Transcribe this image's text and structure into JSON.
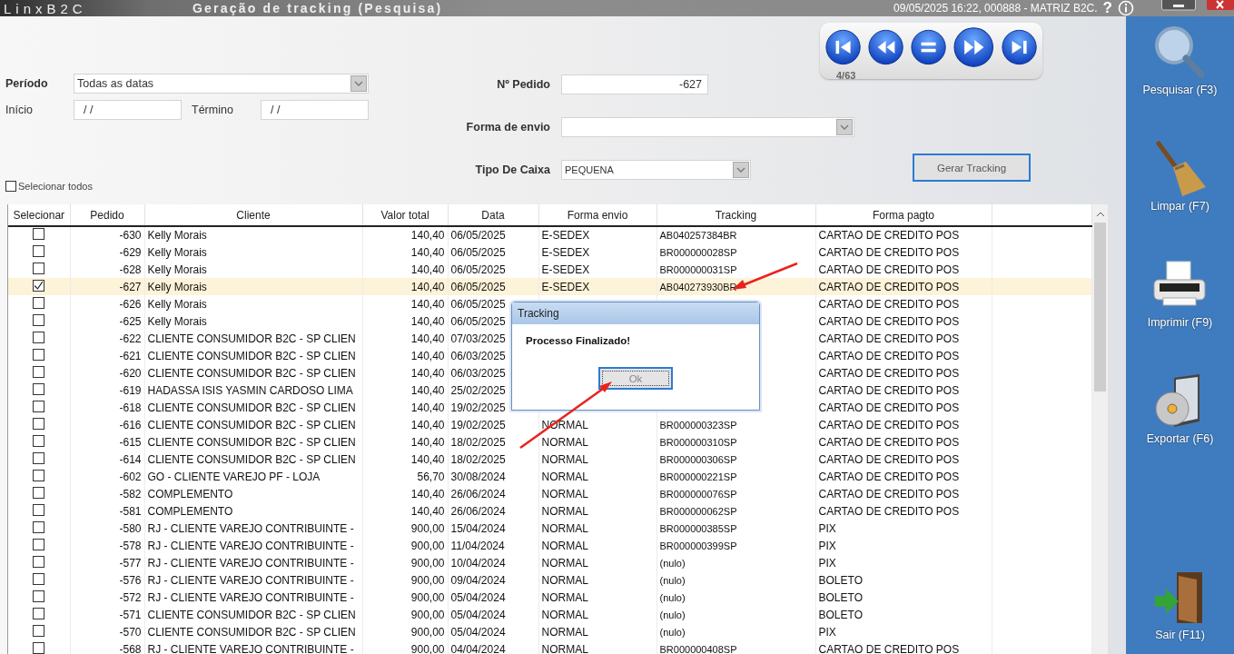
{
  "title_bar": {
    "app_name": "LinxB2C",
    "title": "Geração de tracking (Pesquisa)",
    "session": "09/05/2025 16:22, 000888 - MATRIZ B2C.",
    "help": "?"
  },
  "filters": {
    "periodo": {
      "label": "Período",
      "value": "Todas as datas"
    },
    "inicio": {
      "label": "Início",
      "value": "/ /"
    },
    "termino": {
      "label": "Término",
      "value": "/ /"
    },
    "pedido": {
      "label": "Nº Pedido",
      "value": "-627"
    },
    "forma_envio": {
      "label": "Forma de envio"
    },
    "tipo_caixa": {
      "label": "Tipo De Caixa",
      "value": "PEQUENA"
    },
    "select_all": {
      "label": "Selecionar todos",
      "checked": false
    },
    "generate_button": "Gerar Tracking"
  },
  "navigator": {
    "counter": "4/63"
  },
  "table": {
    "columns": [
      "Selecionar",
      "Pedido",
      "Cliente",
      "Valor total",
      "Data",
      "Forma envio",
      "Tracking",
      "Forma pagto"
    ],
    "rows": [
      {
        "checked": false,
        "selected": false,
        "pedido": "-630",
        "cliente": "Kelly Morais",
        "valor": "140,40",
        "data": "06/05/2025",
        "envio": "E-SEDEX",
        "tracking": "AB040257384BR",
        "pagto": "CARTAO DE CREDITO POS"
      },
      {
        "checked": false,
        "selected": false,
        "pedido": "-629",
        "cliente": "Kelly Morais",
        "valor": "140,40",
        "data": "06/05/2025",
        "envio": "E-SEDEX",
        "tracking": "BR000000028SP",
        "pagto": "CARTAO DE CREDITO POS"
      },
      {
        "checked": false,
        "selected": false,
        "pedido": "-628",
        "cliente": "Kelly Morais",
        "valor": "140,40",
        "data": "06/05/2025",
        "envio": "E-SEDEX",
        "tracking": "BR000000031SP",
        "pagto": "CARTAO DE CREDITO POS"
      },
      {
        "checked": true,
        "selected": true,
        "pedido": "-627",
        "cliente": "Kelly Morais",
        "valor": "140,40",
        "data": "06/05/2025",
        "envio": "E-SEDEX",
        "tracking": "AB040273930BR",
        "pagto": "CARTAO DE CREDITO POS"
      },
      {
        "checked": false,
        "selected": false,
        "pedido": "-626",
        "cliente": "Kelly Morais",
        "valor": "140,40",
        "data": "06/05/2025",
        "pagto": "CARTAO DE CREDITO POS"
      },
      {
        "checked": false,
        "selected": false,
        "pedido": "-625",
        "cliente": "Kelly Morais",
        "valor": "140,40",
        "data": "06/05/2025",
        "pagto": "CARTAO DE CREDITO POS"
      },
      {
        "checked": false,
        "selected": false,
        "pedido": "-622",
        "cliente": "CLIENTE CONSUMIDOR B2C - SP CLIEN",
        "valor": "140,40",
        "data": "07/03/2025",
        "pagto": "CARTAO DE CREDITO POS"
      },
      {
        "checked": false,
        "selected": false,
        "pedido": "-621",
        "cliente": "CLIENTE CONSUMIDOR B2C - SP CLIEN",
        "valor": "140,40",
        "data": "06/03/2025",
        "pagto": "CARTAO DE CREDITO POS"
      },
      {
        "checked": false,
        "selected": false,
        "pedido": "-620",
        "cliente": "CLIENTE CONSUMIDOR B2C - SP CLIEN",
        "valor": "140,40",
        "data": "06/03/2025",
        "pagto": "CARTAO DE CREDITO POS"
      },
      {
        "checked": false,
        "selected": false,
        "pedido": "-619",
        "cliente": "HADASSA ISIS YASMIN CARDOSO LIMA",
        "valor": "140,40",
        "data": "25/02/2025",
        "pagto": "CARTAO DE CREDITO POS"
      },
      {
        "checked": false,
        "selected": false,
        "pedido": "-618",
        "cliente": "CLIENTE CONSUMIDOR B2C - SP CLIEN",
        "valor": "140,40",
        "data": "19/02/2025",
        "pagto": "CARTAO DE CREDITO POS"
      },
      {
        "checked": false,
        "selected": false,
        "pedido": "-616",
        "cliente": "CLIENTE CONSUMIDOR B2C - SP CLIEN",
        "valor": "140,40",
        "data": "19/02/2025",
        "envio": "NORMAL",
        "tracking": "BR000000323SP",
        "pagto": "CARTAO DE CREDITO POS"
      },
      {
        "checked": false,
        "selected": false,
        "pedido": "-615",
        "cliente": "CLIENTE CONSUMIDOR B2C - SP CLIEN",
        "valor": "140,40",
        "data": "18/02/2025",
        "envio": "NORMAL",
        "tracking": "BR000000310SP",
        "pagto": "CARTAO DE CREDITO POS"
      },
      {
        "checked": false,
        "selected": false,
        "pedido": "-614",
        "cliente": "CLIENTE CONSUMIDOR B2C - SP CLIEN",
        "valor": "140,40",
        "data": "18/02/2025",
        "envio": "NORMAL",
        "tracking": "BR000000306SP",
        "pagto": "CARTAO DE CREDITO POS"
      },
      {
        "checked": false,
        "selected": false,
        "pedido": "-602",
        "cliente": "GO - CLIENTE VAREJO PF - LOJA",
        "valor": "56,70",
        "data": "30/08/2024",
        "envio": "NORMAL",
        "tracking": "BR000000221SP",
        "pagto": "CARTAO DE CREDITO POS"
      },
      {
        "checked": false,
        "selected": false,
        "pedido": "-582",
        "cliente": "COMPLEMENTO",
        "valor": "140,40",
        "data": "26/06/2024",
        "envio": "NORMAL",
        "tracking": "BR000000076SP",
        "pagto": "CARTAO DE CREDITO POS"
      },
      {
        "checked": false,
        "selected": false,
        "pedido": "-581",
        "cliente": "COMPLEMENTO",
        "valor": "140,40",
        "data": "26/06/2024",
        "envio": "NORMAL",
        "tracking": "BR000000062SP",
        "pagto": "CARTAO DE CREDITO POS"
      },
      {
        "checked": false,
        "selected": false,
        "pedido": "-580",
        "cliente": "RJ - CLIENTE VAREJO CONTRIBUINTE -",
        "valor": "900,00",
        "data": "15/04/2024",
        "envio": "NORMAL",
        "tracking": "BR000000385SP",
        "pagto": "PIX"
      },
      {
        "checked": false,
        "selected": false,
        "pedido": "-578",
        "cliente": "RJ - CLIENTE VAREJO CONTRIBUINTE -",
        "valor": "900,00",
        "data": "11/04/2024",
        "envio": "NORMAL",
        "tracking": "BR000000399SP",
        "pagto": "PIX"
      },
      {
        "checked": false,
        "selected": false,
        "pedido": "-577",
        "cliente": "RJ - CLIENTE VAREJO CONTRIBUINTE -",
        "valor": "900,00",
        "data": "10/04/2024",
        "envio": "NORMAL",
        "tracking": "(nulo)",
        "pagto": "PIX"
      },
      {
        "checked": false,
        "selected": false,
        "pedido": "-576",
        "cliente": "RJ - CLIENTE VAREJO CONTRIBUINTE -",
        "valor": "900,00",
        "data": "09/04/2024",
        "envio": "NORMAL",
        "tracking": "(nulo)",
        "pagto": "BOLETO"
      },
      {
        "checked": false,
        "selected": false,
        "pedido": "-572",
        "cliente": "RJ - CLIENTE VAREJO CONTRIBUINTE -",
        "valor": "900,00",
        "data": "05/04/2024",
        "envio": "NORMAL",
        "tracking": "(nulo)",
        "pagto": "BOLETO"
      },
      {
        "checked": false,
        "selected": false,
        "pedido": "-571",
        "cliente": "CLIENTE CONSUMIDOR B2C - SP CLIEN",
        "valor": "900,00",
        "data": "05/04/2024",
        "envio": "NORMAL",
        "tracking": "(nulo)",
        "pagto": "BOLETO"
      },
      {
        "checked": false,
        "selected": false,
        "pedido": "-570",
        "cliente": "CLIENTE CONSUMIDOR B2C - SP CLIEN",
        "valor": "900,00",
        "data": "05/04/2024",
        "envio": "NORMAL",
        "tracking": "(nulo)",
        "pagto": "PIX"
      },
      {
        "checked": false,
        "selected": false,
        "pedido": "-568",
        "cliente": "RJ - CLIENTE VAREJO CONTRIBUINTE -",
        "valor": "900,00",
        "data": "04/04/2024",
        "envio": "NORMAL",
        "tracking": "BR000000408SP",
        "pagto": "CARTAO DE CREDITO POS"
      }
    ]
  },
  "dialog": {
    "title": "Tracking",
    "message": "Processo Finalizado!",
    "button": "Ok"
  },
  "sidebar": [
    {
      "kind": "search",
      "label": "Pesquisar (F3)"
    },
    {
      "kind": "clear",
      "label": "Limpar (F7)"
    },
    {
      "kind": "print",
      "label": "Imprimir (F9)"
    },
    {
      "kind": "export",
      "label": "Exportar (F6)"
    },
    {
      "kind": "exit",
      "label": "Sair (F11)"
    }
  ]
}
